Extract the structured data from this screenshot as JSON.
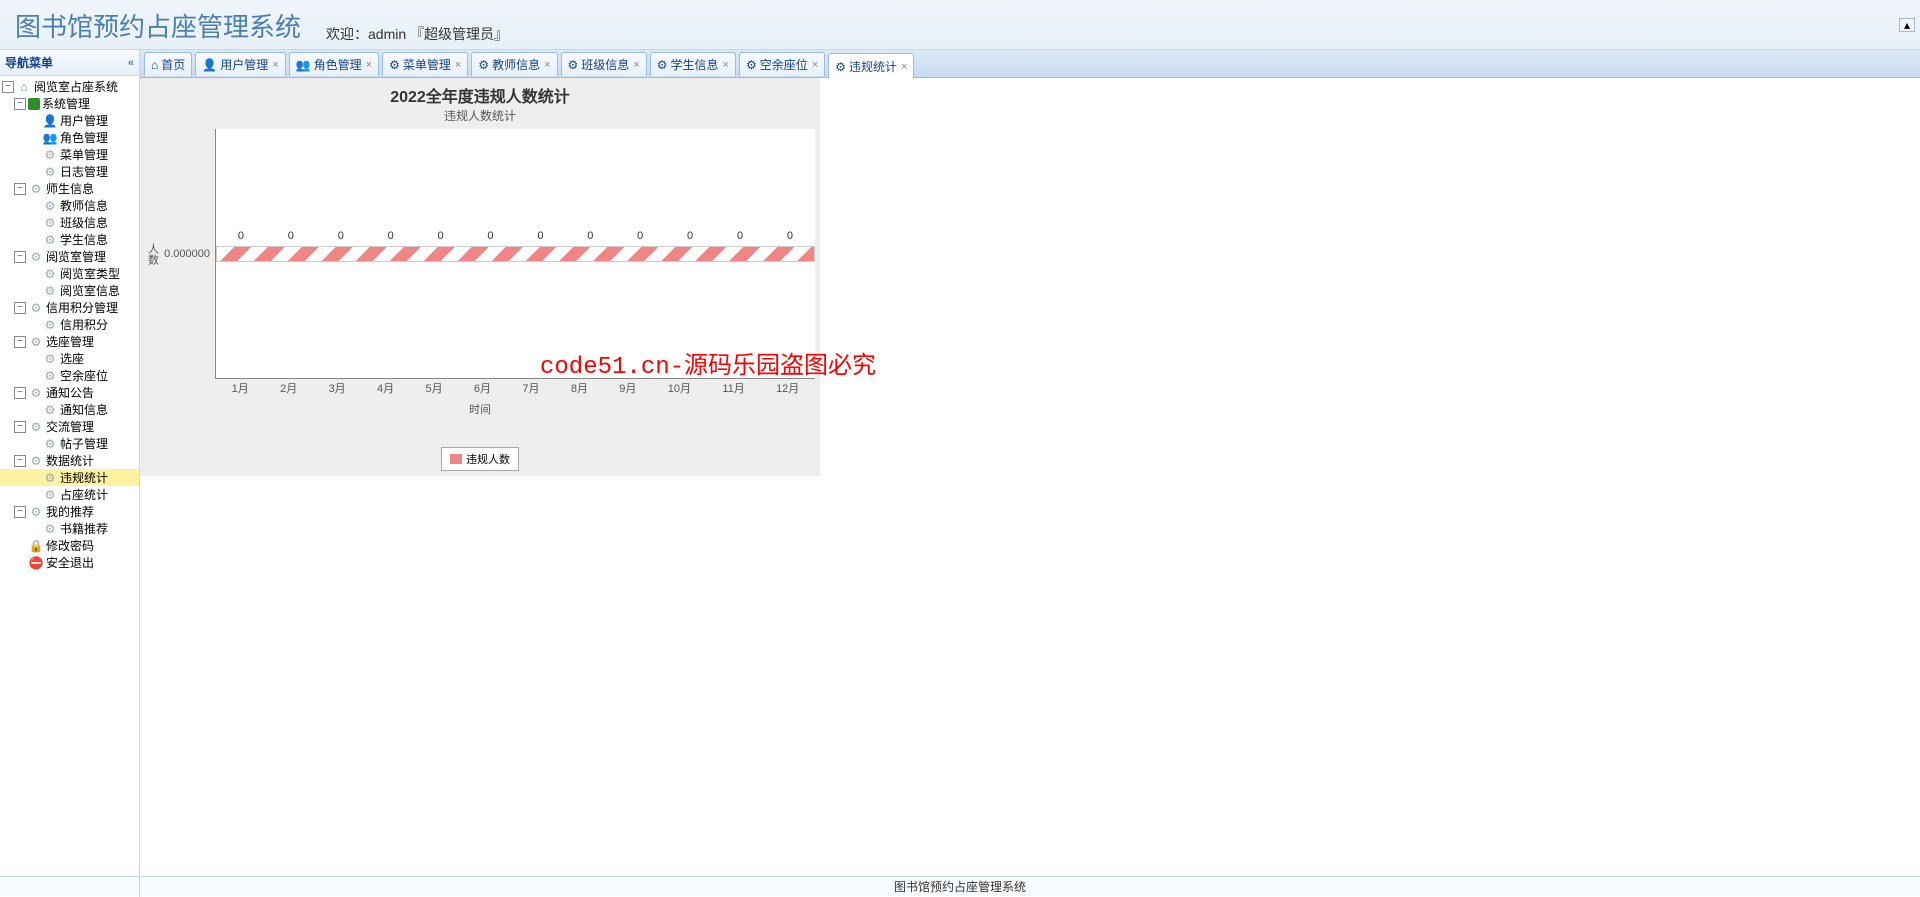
{
  "header": {
    "app_title": "图书馆预约占座管理系统",
    "welcome_prefix": "欢迎：",
    "username": "admin",
    "role": "『超级管理员』"
  },
  "sidebar": {
    "title": "导航菜单",
    "root": "阅览室占座系统",
    "groups": [
      {
        "label": "系统管理",
        "children": [
          "用户管理",
          "角色管理",
          "菜单管理",
          "日志管理"
        ]
      },
      {
        "label": "师生信息",
        "children": [
          "教师信息",
          "班级信息",
          "学生信息"
        ]
      },
      {
        "label": "阅览室管理",
        "children": [
          "阅览室类型",
          "阅览室信息"
        ]
      },
      {
        "label": "信用积分管理",
        "children": [
          "信用积分"
        ]
      },
      {
        "label": "选座管理",
        "children": [
          "选座",
          "空余座位"
        ]
      },
      {
        "label": "通知公告",
        "children": [
          "通知信息"
        ]
      },
      {
        "label": "交流管理",
        "children": [
          "帖子管理"
        ]
      },
      {
        "label": "数据统计",
        "children": [
          "违规统计",
          "占座统计"
        ]
      },
      {
        "label": "我的推荐",
        "children": [
          "书籍推荐"
        ]
      }
    ],
    "extras": [
      "修改密码",
      "安全退出"
    ]
  },
  "tabs": [
    {
      "label": "首页",
      "closable": false,
      "icon": "home"
    },
    {
      "label": "用户管理",
      "closable": true,
      "icon": "user"
    },
    {
      "label": "角色管理",
      "closable": true,
      "icon": "role"
    },
    {
      "label": "菜单管理",
      "closable": true,
      "icon": "gear"
    },
    {
      "label": "教师信息",
      "closable": true,
      "icon": "gear"
    },
    {
      "label": "班级信息",
      "closable": true,
      "icon": "gear"
    },
    {
      "label": "学生信息",
      "closable": true,
      "icon": "gear"
    },
    {
      "label": "空余座位",
      "closable": true,
      "icon": "gear"
    },
    {
      "label": "违规统计",
      "closable": true,
      "icon": "gear",
      "active": true
    }
  ],
  "chart_data": {
    "type": "bar",
    "title": "2022全年度违规人数统计",
    "subtitle": "违规人数统计",
    "xlabel": "时间",
    "ylabel": "人数",
    "categories": [
      "1月",
      "2月",
      "3月",
      "4月",
      "5月",
      "6月",
      "7月",
      "8月",
      "9月",
      "10月",
      "11月",
      "12月"
    ],
    "series": [
      {
        "name": "违规人数",
        "values": [
          0,
          0,
          0,
          0,
          0,
          0,
          0,
          0,
          0,
          0,
          0,
          0
        ],
        "color": "#f08585"
      }
    ],
    "y_tick": "0.000000",
    "ylim": [
      0,
      1
    ]
  },
  "watermark": "code51.cn-源码乐园盗图必究",
  "footer": "图书馆预约占座管理系统"
}
